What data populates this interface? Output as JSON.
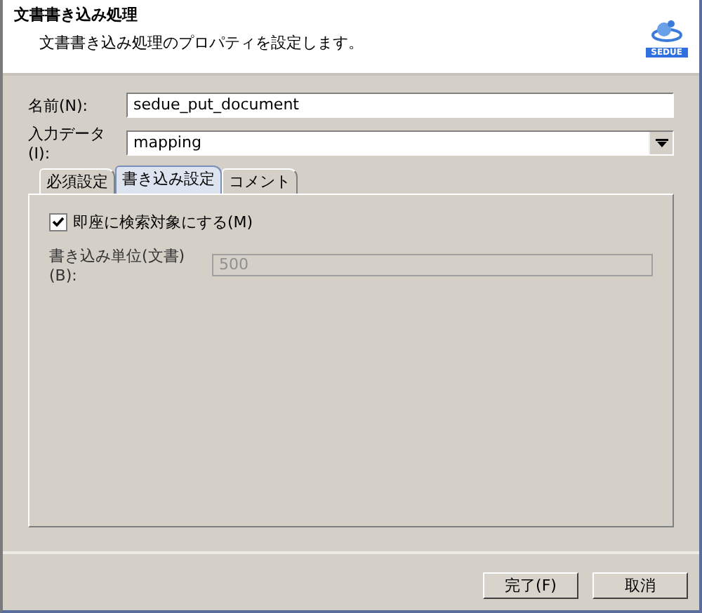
{
  "header": {
    "title": "文書書き込み処理",
    "description": "文書書き込み処理のプロパティを設定します。",
    "logo_text": "SEDUE"
  },
  "fields": [
    {
      "kind": "text",
      "label": "名前(N):",
      "value": "sedue_put_document"
    },
    {
      "kind": "dropdown",
      "label": "入力データ(I):",
      "value": "mapping"
    }
  ],
  "tabs": [
    {
      "label": "必須設定",
      "selected": false
    },
    {
      "label": "書き込み設定",
      "selected": true
    },
    {
      "label": "コメント",
      "selected": false
    }
  ],
  "tab_content": {
    "checkbox": {
      "label": "即座に検索対象にする(M)",
      "checked": true
    },
    "unit_field": {
      "label": "書き込み単位(文書)(B):",
      "value": "500",
      "disabled": true
    }
  },
  "buttons": [
    "完了(F)",
    "取消"
  ]
}
